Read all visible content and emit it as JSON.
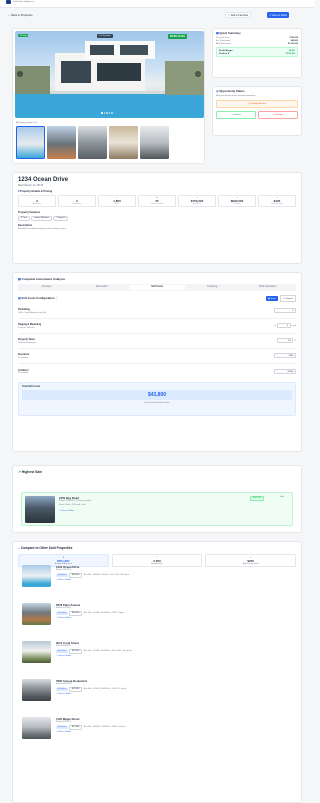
{
  "brand": {
    "title": "Real Estate Intelligence"
  },
  "nav": {
    "back": "Back to Properties",
    "favorite": "Add to Favorites",
    "zillow": "View on Zillow"
  },
  "gallery": {
    "days_badge": "14 Days",
    "photo_count": "1 of 5 photos",
    "profit_badge": "28.8% Profit",
    "caption": "All Property Photos (14)"
  },
  "quick_summary": {
    "title": "Quick Summary",
    "rows": [
      {
        "label": "Purchase Price",
        "value": "$750,000"
      },
      {
        "label": "Est. Renovation",
        "value": "$43,800"
      },
      {
        "label": "ARV (Estimated)",
        "value": "$1,012,000"
      }
    ],
    "profit_margin": {
      "label": "Profit Margin",
      "value": "28.8%"
    },
    "profit": {
      "label": "Profit in $",
      "value": "$135,000"
    }
  },
  "opportunity": {
    "title": "Opportunity Status",
    "subtitle": "Mark your decision on this investment opportunity",
    "status": "Pending Review",
    "interested": "Interest",
    "decline": "Decline"
  },
  "property": {
    "address": "1234 Ocean Drive",
    "city": "Miami Beach, FL 33139",
    "details_title": "Property Details & Pricing",
    "stats": [
      {
        "value": "3",
        "label": "Bedrooms"
      },
      {
        "value": "2",
        "label": "Bathrooms"
      },
      {
        "value": "1,850",
        "label": "Sq Ft"
      },
      {
        "value": "25",
        "label": "Days on market"
      },
      {
        "value": "$750,000",
        "label": "Sold Price"
      },
      {
        "value": "$690,000",
        "label": "Purchase"
      },
      {
        "value": "$405",
        "label": "Price per Sq Ft"
      }
    ],
    "features_title": "Property Features",
    "features": [
      "2 Pool",
      "Impact Windows",
      "2 Story Int"
    ],
    "description_title": "Description",
    "description": "Beautiful oceanfront property with stunning views"
  },
  "analysis": {
    "title": "Complete Investment Analysis",
    "tabs": [
      "Overview",
      "Renovation",
      "Soft Costs",
      "Financing",
      "Profit Calculation"
    ],
    "active_tab": "Soft Costs",
    "config_title": "Soft Costs Configuration",
    "btn_save": "Save",
    "btn_cancel": "Cancel",
    "fields": [
      {
        "label": "Permitting",
        "sub": "1-800 + Grand Monthly as per Sq ft",
        "value": "3"
      },
      {
        "label": "Staging & Marketing",
        "sub": "Per sq ft x 1850 sq ft",
        "value": "4",
        "unit": "/sq ft"
      },
      {
        "label": "Property Taxes",
        "sub": "1.8% of purchase price",
        "value": "1.8",
        "unit": "%"
      },
      {
        "label": "Insurance",
        "sub": "Per property",
        "value": "5000"
      },
      {
        "label": "Architect",
        "sub": "Per property",
        "value": "15000"
      }
    ],
    "total_label": "Total Soft Costs",
    "total_value": "$43,800",
    "total_note": "This total will auto-fill into above"
  },
  "highest_sale": {
    "title": "Highest Sale",
    "address": "2450 Bay Road",
    "sold": "Sold on 11/20/2023 • 31 days on market",
    "price_badge": "$ 987,000",
    "sold_badge": "Sold",
    "specs": "4 bed • 3 bath • 2,200 sq ft • Pool",
    "link": "View on Zillow"
  },
  "compare": {
    "title": "Compare to Other Sold Properties",
    "stats": [
      {
        "value": "$551,667",
        "label": "Average Selling Price"
      },
      {
        "value": "2,050",
        "label": "Average Sq Ft"
      },
      {
        "value": "$250",
        "label": "Avg Price per Sq Ft"
      }
    ],
    "items": [
      {
        "address": "1234 Ocean Drive",
        "sold": "Sold on 12/5/2024",
        "price": "$ 640,000",
        "ppsf": "$248/SF",
        "specs": "3bd • 2ba • 1,850SF • 1,969 lot",
        "extra": "Pool • 2024 • 280 sq feet",
        "link": "View on Zillow"
      },
      {
        "address": "5678 Palm Avenue",
        "sold": "Sold on 1/15/2024",
        "price": "$ 520,000",
        "ppsf": "$260/SF",
        "specs": "3bd • 2ba • 2,100SF • 8,500SF lot",
        "extra": "1985 • 14 days",
        "link": "View on Zillow"
      },
      {
        "address": "9012 Coral Street",
        "sold": "Sold on 2/28/2024",
        "price": "$ 495,000",
        "ppsf": "$226/SF",
        "specs": "3bd • 2ba • 1,700SF • 6,000SF lot",
        "extra": "Pool • 2021 • 160 sq feet",
        "link": "View on Zillow"
      },
      {
        "address": "7890 Sunset Boulevard",
        "sold": "Sold on 10/10/2023",
        "price": "$ 558,000",
        "ppsf": "$228/SF",
        "specs": "4bd • 3ba • 2,300SF • 9,000SF lot",
        "extra": "2005 • 112 sq feet",
        "link": "View on Zillow"
      },
      {
        "address": "1122 Maple Street",
        "sold": "Sold on 8/15/2023",
        "price": "$ 590,000",
        "ppsf": "$270/SF",
        "specs": "3bd • 2ba • 2,185SF • 7,500SF lot",
        "extra": "2008 • 40 sq feet",
        "link": "View on Zillow"
      }
    ]
  }
}
